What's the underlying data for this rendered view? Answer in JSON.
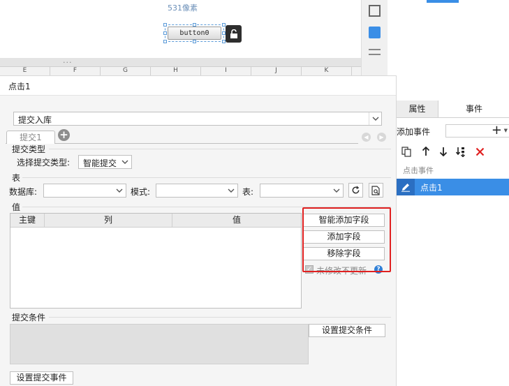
{
  "canvas": {
    "size_label": "531像素",
    "button_label": "button0",
    "dots": "...",
    "columns": [
      "E",
      "F",
      "G",
      "H",
      "I",
      "J",
      "K"
    ]
  },
  "dialog": {
    "title": "点击1",
    "action_type": "提交入库",
    "tab_label": "提交1",
    "submit_type_section": "提交类型",
    "choose_type_label": "选择提交类型:",
    "choose_type_value": "智能提交",
    "table_section": "表",
    "database_label": "数据库:",
    "mode_label": "模式:",
    "table_label": "表:",
    "database_value": "",
    "mode_value": "",
    "table_value": "",
    "value_section": "值",
    "columns": {
      "key": "主键",
      "col": "列",
      "value": "值"
    },
    "buttons": {
      "smart_add": "智能添加字段",
      "add": "添加字段",
      "remove": "移除字段"
    },
    "checkbox_label": "未修改不更新",
    "condition_section": "提交条件",
    "set_condition": "设置提交条件",
    "set_event": "设置提交事件"
  },
  "right_panel": {
    "tab_properties": "属性",
    "tab_events": "事件",
    "add_event_label": "添加事件",
    "event_group": "点击事件",
    "event_item": "点击1",
    "accent_color": "#3a8ee6"
  }
}
